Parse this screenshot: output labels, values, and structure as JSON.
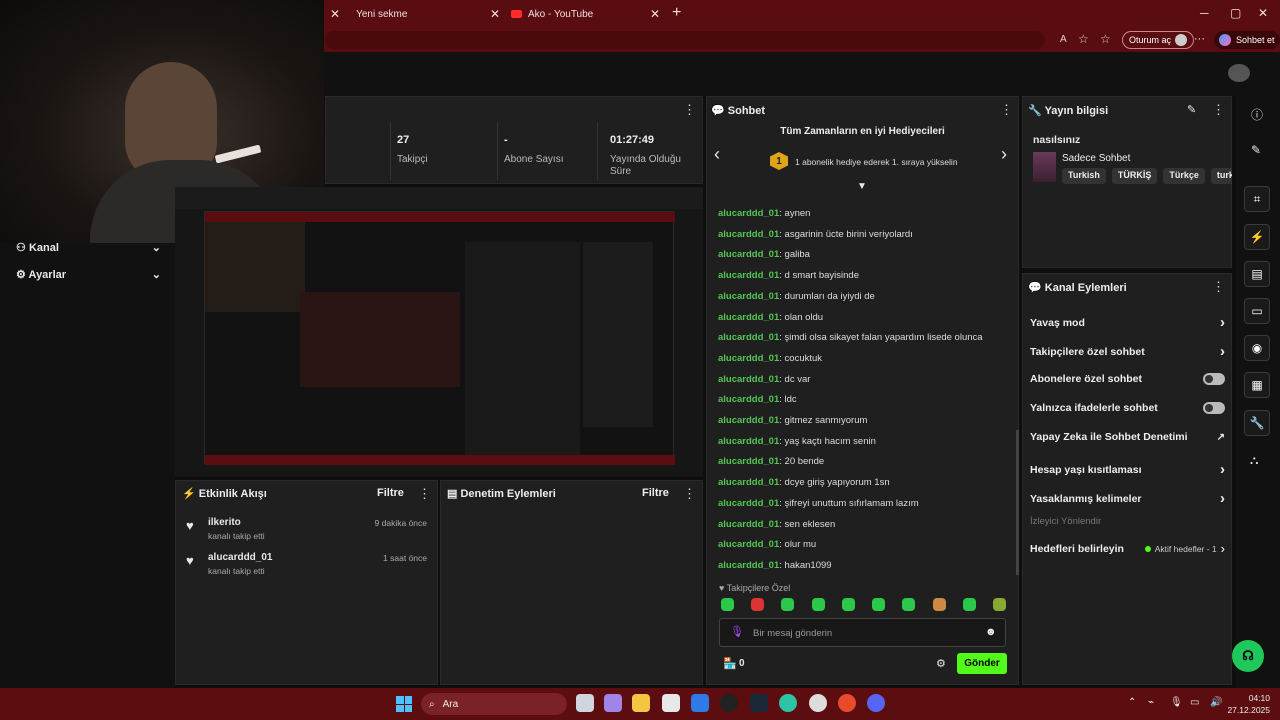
{
  "browser": {
    "tabs": [
      {
        "label": "Yeni sekme"
      },
      {
        "label": "Ako - YouTube"
      }
    ],
    "login_label": "Oturum aç",
    "copilot_label": "Sohbet et"
  },
  "stats": [
    {
      "value": "27",
      "label": "Takipçi"
    },
    {
      "value": "-",
      "label": "Abone Sayısı"
    },
    {
      "value": "01:27:49",
      "label": "Yayında Olduğu Süre"
    }
  ],
  "left_nav": [
    {
      "label": "Kanal"
    },
    {
      "label": "Ayarlar"
    }
  ],
  "activity": {
    "title": "Etkinlik Akışı",
    "filter": "Filtre",
    "items": [
      {
        "user": "ilkerito",
        "desc": "kanalı takip etti",
        "time": "9 dakika önce"
      },
      {
        "user": "alucarddd_01",
        "desc": "kanalı takip etti",
        "time": "1 saat önce"
      }
    ]
  },
  "moderation": {
    "title": "Denetim Eylemleri",
    "filter": "Filtre"
  },
  "chat": {
    "title": "Sohbet",
    "banner_title": "Tüm Zamanların en iyi Hediyecileri",
    "banner_rank": "1",
    "banner_text": "1 abonelik hediye ederek 1. sıraya yükselin",
    "messages": [
      {
        "user": "alucarddd_01",
        "text": "aynen"
      },
      {
        "user": "alucarddd_01",
        "text": "asgarinin ücte birini veriyolardı"
      },
      {
        "user": "alucarddd_01",
        "text": "galiba"
      },
      {
        "user": "alucarddd_01",
        "text": "d smart bayisinde"
      },
      {
        "user": "alucarddd_01",
        "text": "durumları da iyiydi de"
      },
      {
        "user": "alucarddd_01",
        "text": "olan oldu"
      },
      {
        "user": "alucarddd_01",
        "text": "şimdi olsa sikayet falan yapardım lisede olunca"
      },
      {
        "user": "alucarddd_01",
        "text": "cocuktuk"
      },
      {
        "user": "alucarddd_01",
        "text": "dc var"
      },
      {
        "user": "alucarddd_01",
        "text": "ldc"
      },
      {
        "user": "alucarddd_01",
        "text": "gitmez sanmıyorum"
      },
      {
        "user": "alucarddd_01",
        "text": "yaş kaçtı hacım senin"
      },
      {
        "user": "alucarddd_01",
        "text": "20 bende"
      },
      {
        "user": "alucarddd_01",
        "text": "dcye giriş yapıyorum 1sn"
      },
      {
        "user": "alucarddd_01",
        "text": "şifreyi unuttum sıfırlamam lazım"
      },
      {
        "user": "alucarddd_01",
        "text": "sen eklesen"
      },
      {
        "user": "alucarddd_01",
        "text": "olur mu"
      },
      {
        "user": "alucarddd_01",
        "text": "hakan1099"
      }
    ],
    "followers_only": "Takipçilere Özel",
    "input_placeholder": "Bir mesaj gönderin",
    "points": "0",
    "send": "Gönder"
  },
  "stream_info": {
    "title": "Yayın bilgisi",
    "stream_title": "nasılsınız",
    "category": "Sadece Sohbet",
    "tags": [
      "Turkish",
      "TÜRKİŞ",
      "Türkçe",
      "turkis"
    ]
  },
  "channel_actions": {
    "title": "Kanal Eylemleri",
    "items": [
      {
        "label": "Yavaş mod",
        "ctrl": "chevron"
      },
      {
        "label": "Takipçilere özel sohbet",
        "ctrl": "chevron"
      },
      {
        "label": "Abonelere özel sohbet",
        "ctrl": "toggle"
      },
      {
        "label": "Yalnızca ifadelerle sohbet",
        "ctrl": "toggle"
      },
      {
        "label": "Yapay Zeka ile Sohbet Denetimi",
        "ctrl": "external"
      },
      {
        "label": "Hesap yaşı kısıtlaması",
        "ctrl": "chevron"
      },
      {
        "label": "Yasaklanmış kelimeler",
        "ctrl": "chevron"
      }
    ],
    "viewer_directs": "İzleyici Yönlendir",
    "goals_label": "Hedefleri belirleyin",
    "goals_status": "Aktif hedefler - 1"
  },
  "taskbar": {
    "search": "Ara",
    "time": "04:10",
    "date": "27.12.2025"
  }
}
